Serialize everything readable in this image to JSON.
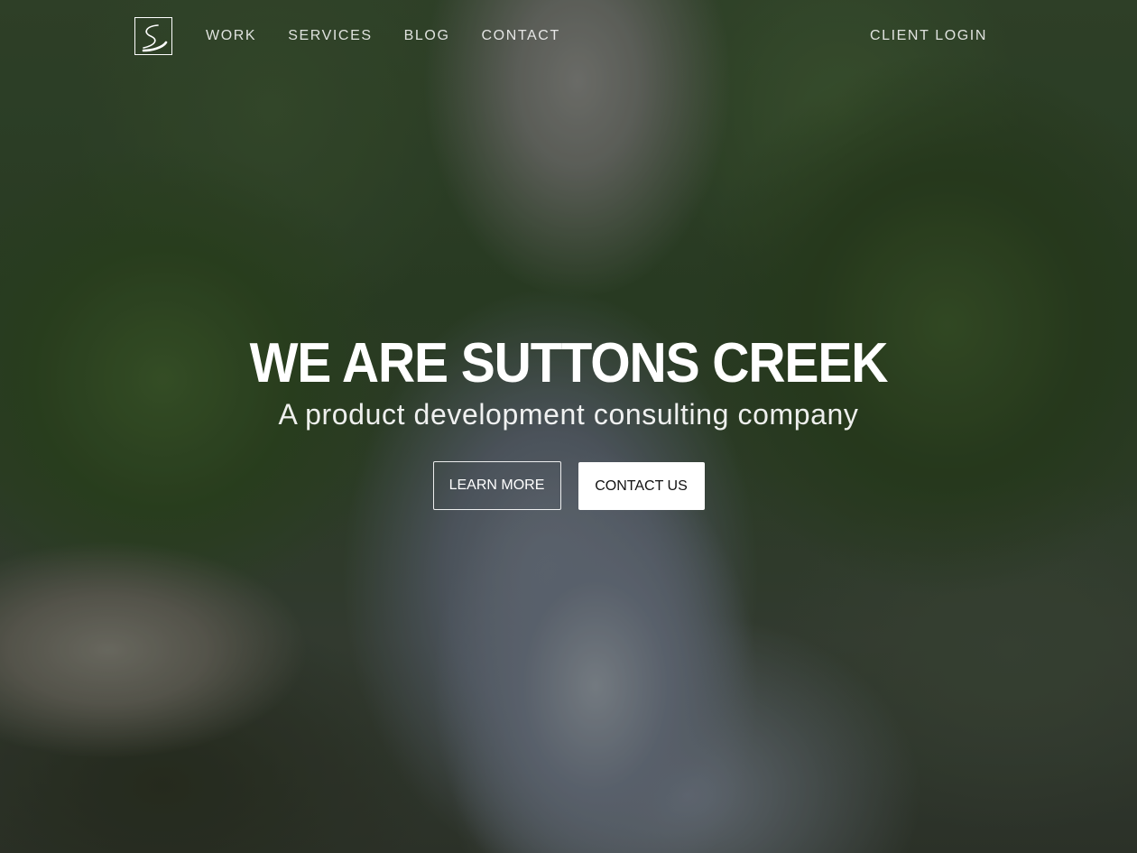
{
  "nav": {
    "links": [
      "WORK",
      "SERVICES",
      "BLOG",
      "CONTACT"
    ],
    "client_login": "CLIENT LOGIN",
    "logo_icon": "suttons-creek-s-logo-icon"
  },
  "hero": {
    "headline": "WE ARE SUTTONS CREEK",
    "tagline": "A product development consulting company",
    "buttons": {
      "learn_more": "LEARN MORE",
      "contact_us": "CONTACT US"
    }
  },
  "colors": {
    "text": "#ffffff",
    "solid_button_bg": "#ffffff",
    "solid_button_text": "#111111"
  }
}
